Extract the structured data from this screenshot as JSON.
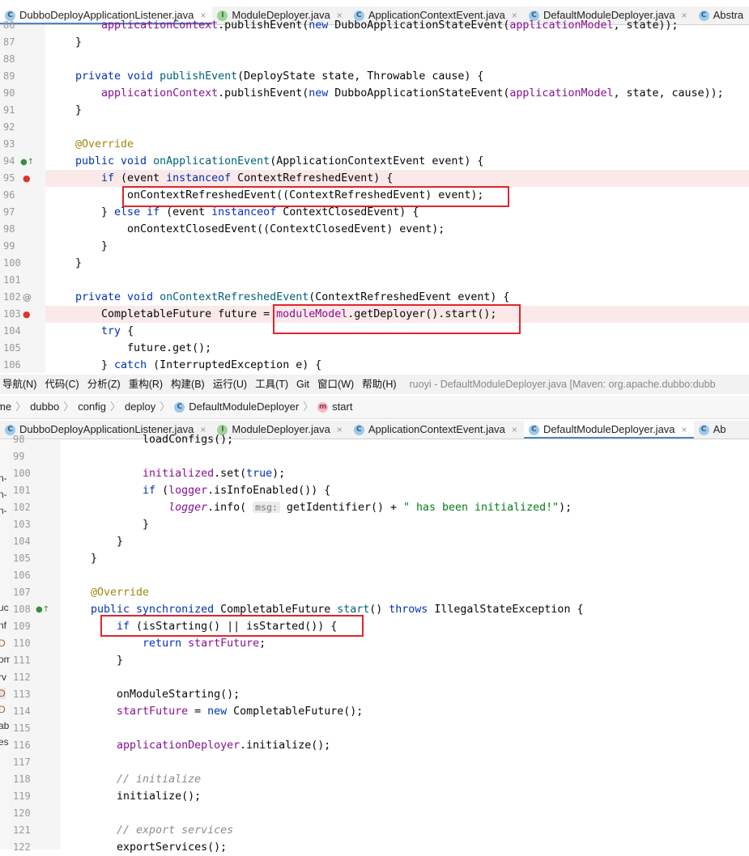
{
  "top_tabs": [
    {
      "label": "DubboDeployApplicationListener.java",
      "icon": "class-icon",
      "active": true
    },
    {
      "label": "ModuleDeployer.java",
      "icon": "interface-icon",
      "active": false
    },
    {
      "label": "ApplicationContextEvent.java",
      "icon": "class-icon",
      "active": false
    },
    {
      "label": "DefaultModuleDeployer.java",
      "icon": "class-icon",
      "active": false
    },
    {
      "label": "Abstra",
      "icon": "class-icon",
      "active": false
    }
  ],
  "top_lines": [
    "86",
    "87",
    "88",
    "89",
    "90",
    "91",
    "92",
    "93",
    "94",
    "95",
    "96",
    "97",
    "98",
    "99",
    "100",
    "101",
    "102",
    "103",
    "104",
    "105",
    "106"
  ],
  "menu": {
    "items": [
      "导航(N)",
      "代码(C)",
      "分析(Z)",
      "重构(R)",
      "构建(B)",
      "运行(U)",
      "工具(T)",
      "Git",
      "窗口(W)",
      "帮助(H)"
    ],
    "title": "ruoyi - DefaultModuleDeployer.java [Maven: org.apache.dubbo:dubb"
  },
  "breadcrumb": [
    "me",
    "dubbo",
    "config",
    "deploy",
    "DefaultModuleDeployer",
    "start"
  ],
  "bottom_tabs": [
    {
      "label": "DubboDeployApplicationListener.java",
      "icon": "class-icon",
      "active": false
    },
    {
      "label": "ModuleDeployer.java",
      "icon": "interface-icon",
      "active": false
    },
    {
      "label": "ApplicationContextEvent.java",
      "icon": "class-icon",
      "active": false
    },
    {
      "label": "DefaultModuleDeployer.java",
      "icon": "class-icon",
      "active": true
    },
    {
      "label": "Ab",
      "icon": "class-icon",
      "active": false
    }
  ],
  "bottom_lines": [
    "98",
    "99",
    "100",
    "101",
    "102",
    "103",
    "104",
    "105",
    "106",
    "107",
    "108",
    "109",
    "110",
    "111",
    "112",
    "113",
    "114",
    "115",
    "116",
    "117",
    "118",
    "119",
    "120",
    "121",
    "122"
  ],
  "side_fragments": [
    "n-",
    "n-",
    "n-",
    "uc",
    "nf",
    "D",
    "om",
    "rv",
    "D",
    "D",
    "ab",
    "es"
  ],
  "code_texts": {
    "hint_msg": "msg:",
    "str_initialized": "\" has been initialized!\"",
    "cmt_initialize": "// initialize",
    "cmt_export": "// export services"
  }
}
